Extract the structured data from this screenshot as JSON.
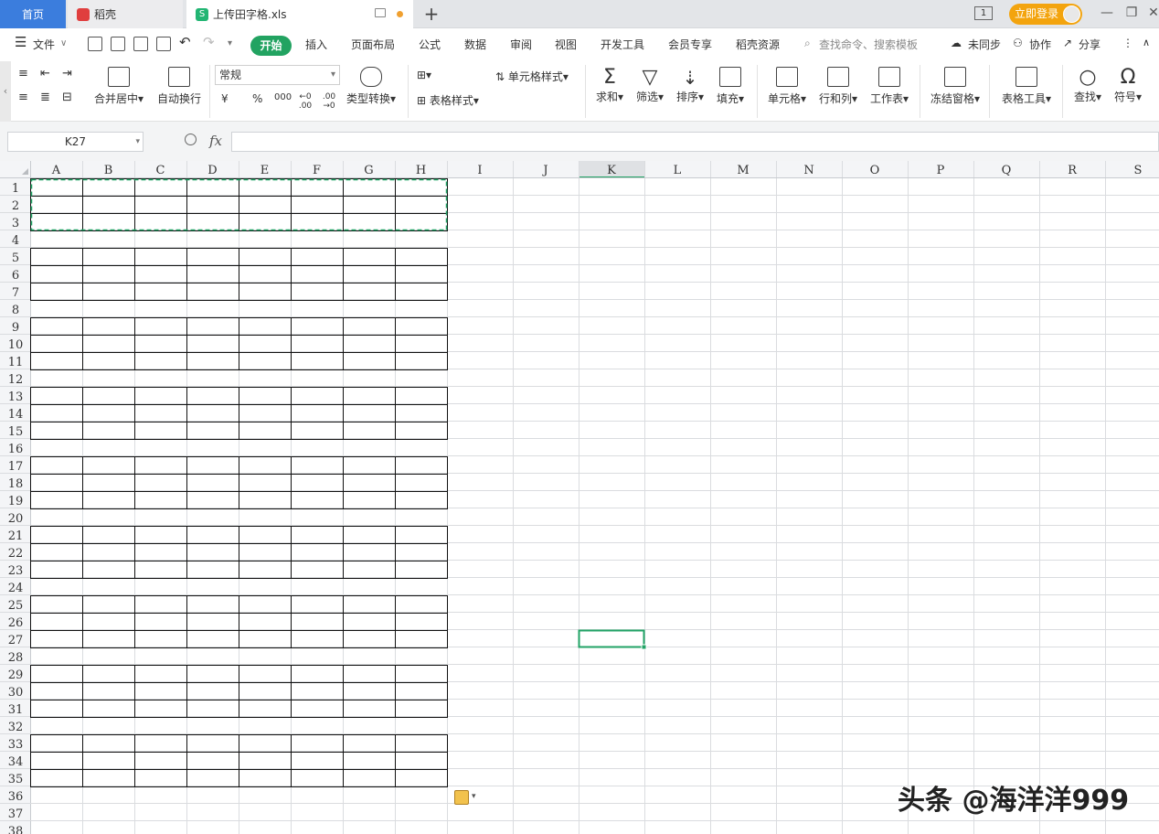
{
  "tabs": {
    "home": "首页",
    "daoke": "稻壳",
    "file": "上传田字格.xls",
    "add": "+"
  },
  "window": {
    "page_indicator": "1",
    "login": "立即登录",
    "min": "—",
    "restore": "❐",
    "close": "✕"
  },
  "menu": {
    "file": "文件",
    "start": "开始",
    "items": [
      "插入",
      "页面布局",
      "公式",
      "数据",
      "审阅",
      "视图",
      "开发工具",
      "会员专享",
      "稻壳资源"
    ],
    "search": "查找命令、搜索模板",
    "unsync": "未同步",
    "collab": "协作",
    "share": "分享"
  },
  "ribbon": {
    "merge": "合并居中",
    "wrap": "自动换行",
    "number_format": "常规",
    "currency": "¥",
    "percent": "%",
    "thousands": "000",
    "dec_inc": "←0 .00",
    "dec_dec": ".00 →0",
    "type_convert": "类型转换",
    "cell_style": "单元格样式",
    "table_style": "表格样式",
    "sum": "求和",
    "filter": "筛选",
    "sort": "排序",
    "fill": "填充",
    "cell": "单元格",
    "row_col": "行和列",
    "worksheet": "工作表",
    "freeze": "冻结窗格",
    "table_tools": "表格工具",
    "find": "查找",
    "symbol": "符号"
  },
  "formula_bar": {
    "name_box": "K27",
    "fx": "fx",
    "formula": ""
  },
  "grid": {
    "columns": [
      "A",
      "B",
      "C",
      "D",
      "E",
      "F",
      "G",
      "H",
      "I",
      "J",
      "K",
      "L",
      "M",
      "N",
      "O",
      "P",
      "Q",
      "R",
      "S"
    ],
    "rows": 38,
    "active_cell": "K27",
    "active_col": "K",
    "active_row": 27,
    "bordered_row_groups": [
      [
        1,
        3
      ],
      [
        5,
        7
      ],
      [
        9,
        11
      ],
      [
        13,
        15
      ],
      [
        17,
        19
      ],
      [
        21,
        23
      ],
      [
        25,
        27
      ],
      [
        29,
        31
      ],
      [
        33,
        35
      ]
    ],
    "bordered_cols": [
      "A",
      "B",
      "C",
      "D",
      "E",
      "F",
      "G",
      "H"
    ],
    "copy_range": "A1:H3",
    "accent_color": "#21a366"
  },
  "watermark": "头条 @海洋洋999"
}
